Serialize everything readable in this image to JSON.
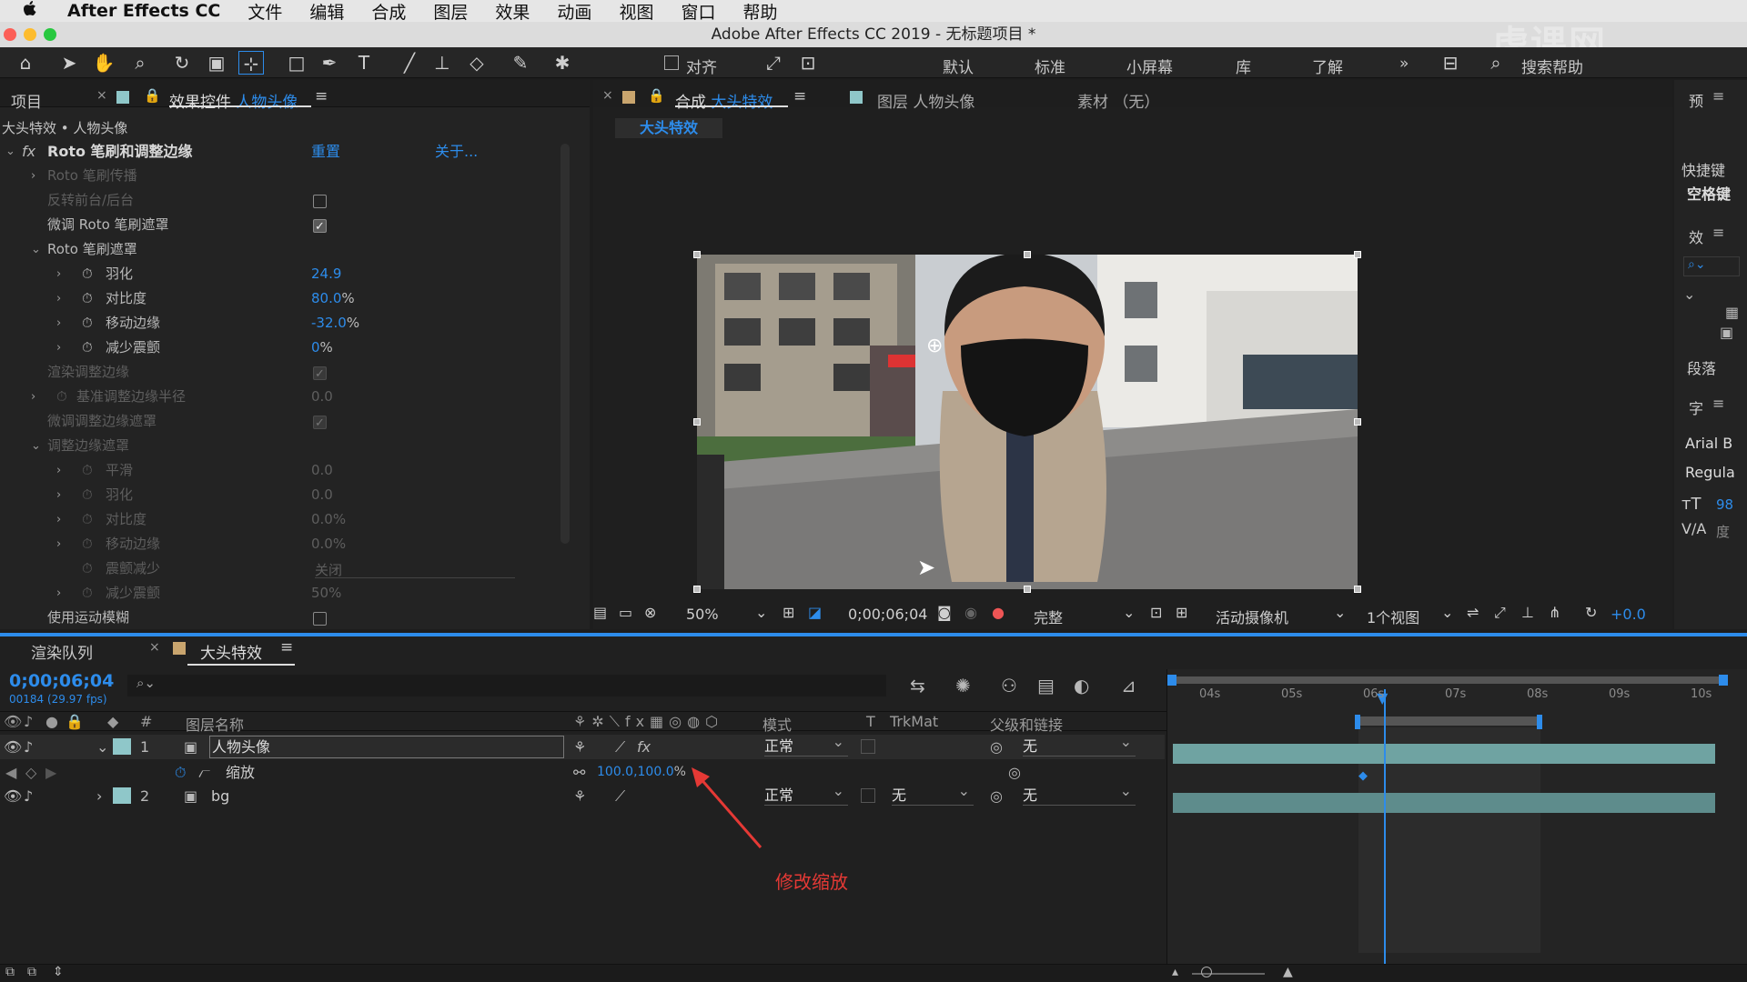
{
  "menubar": {
    "apple": "",
    "app": "After Effects CC",
    "items": [
      "文件",
      "编辑",
      "合成",
      "图层",
      "效果",
      "动画",
      "视图",
      "窗口",
      "帮助"
    ]
  },
  "window_title": "Adobe After Effects CC 2019 - 无标题项目 *",
  "toolbar": {
    "align_label": "对齐",
    "workspaces": [
      "默认",
      "标准",
      "小屏幕",
      "库",
      "了解"
    ],
    "more": "»",
    "search_label": "搜索帮助"
  },
  "left_panel": {
    "project_tab": "项目",
    "effects_tab_prefix": "效果控件",
    "effects_tab_layer": "人物头像",
    "breadcrumb": "大头特效 • 人物头像",
    "effect_name": "Roto 笔刷和调整边缘",
    "reset": "重置",
    "about": "关于...",
    "rows": [
      {
        "label": "Roto 笔刷传播",
        "value": ""
      },
      {
        "label": "反转前台/后台",
        "value": ""
      },
      {
        "label": "微调 Roto 笔刷遮罩",
        "value": ""
      },
      {
        "label": "Roto 笔刷遮罩",
        "value": ""
      },
      {
        "label": "羽化",
        "value": "24.9"
      },
      {
        "label": "对比度",
        "value": "80.0",
        "unit": "%"
      },
      {
        "label": "移动边缘",
        "value": "-32.0",
        "unit": "%"
      },
      {
        "label": "减少震颤",
        "value": "0",
        "unit": "%"
      },
      {
        "label": "渲染调整边缘",
        "value": ""
      },
      {
        "label": "基准调整边缘半径",
        "value": "0.0"
      },
      {
        "label": "微调调整边缘遮罩",
        "value": ""
      },
      {
        "label": "调整边缘遮罩",
        "value": ""
      },
      {
        "label": "平滑",
        "value": "0.0"
      },
      {
        "label": "羽化",
        "value": "0.0"
      },
      {
        "label": "对比度",
        "value": "0.0%"
      },
      {
        "label": "移动边缘",
        "value": "0.0%"
      },
      {
        "label": "震颤减少",
        "value": "关闭"
      },
      {
        "label": "减少震颤",
        "value": "50%"
      },
      {
        "label": "使用运动模糊",
        "value": ""
      }
    ]
  },
  "viewer": {
    "comp_tab_prefix": "合成",
    "comp_tab_name": "大头特效",
    "layer_tab": "图层 人物头像",
    "footage_tab": "素材 （无）",
    "comp_label": "大头特效",
    "zoom": "50%",
    "timecode": "0;00;06;04",
    "quality": "完整",
    "camera": "活动摄像机",
    "views": "1个视图",
    "exposure": "+0.0"
  },
  "right_panel": {
    "panel1": "预",
    "shortcut_label": "快捷键",
    "space_label": "空格键",
    "panel2": "效",
    "paragraph": "段落",
    "char_panel": "字",
    "font": "Arial B",
    "style": "Regula",
    "size": "98",
    "tracking": "度"
  },
  "timeline": {
    "render_tab": "渲染队列",
    "comp_tab": "大头特效",
    "timecode": "0;00;06;04",
    "frames": "00184 (29.97 fps)",
    "headers": {
      "num": "#",
      "name": "图层名称",
      "mode": "模式",
      "t": "T",
      "trkmat": "TrkMat",
      "parent": "父级和链接"
    },
    "ruler": [
      "04s",
      "05s",
      "06s",
      "07s",
      "08s",
      "09s",
      "10s"
    ],
    "layers": [
      {
        "num": "1",
        "name": "人物头像",
        "mode": "正常",
        "trkmat": "",
        "parent": "无"
      },
      {
        "num": "2",
        "name": "bg",
        "mode": "正常",
        "trkmat": "无",
        "parent": "无"
      }
    ],
    "prop_name": "缩放",
    "prop_value": "100.0,100.0",
    "prop_unit": "%"
  },
  "annotation": "修改缩放",
  "watermark": "虎课网",
  "colors": {
    "accent": "#2d8ceb",
    "label_aqua": "#8fc7c9",
    "annotation": "#e53935"
  }
}
